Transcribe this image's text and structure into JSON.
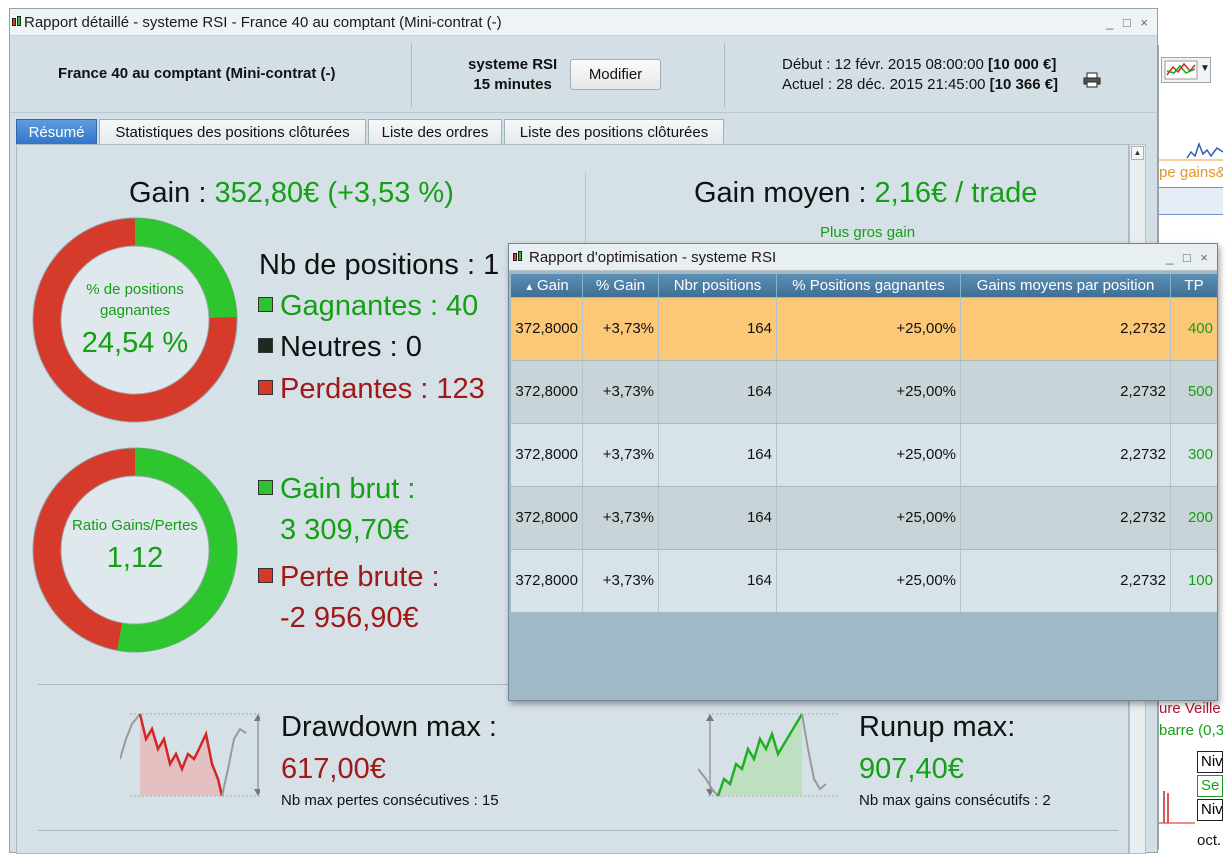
{
  "main_window": {
    "title": "Rapport détaillé - systeme RSI - France 40 au comptant (Mini-contrat  (-)",
    "controls": "_ □ ×"
  },
  "header": {
    "instrument": "France 40 au comptant (Mini-contrat  (-)",
    "system_name": "systeme RSI",
    "timeframe": "15 minutes",
    "modify_label": "Modifier",
    "start_label": "Début :",
    "start_date": "12 févr. 2015 08:00:00",
    "start_capital": "[10 000 €]",
    "current_label": "Actuel :",
    "current_date": "28 déc. 2015 21:45:00",
    "current_capital": "[10 366 €]"
  },
  "tabs": [
    {
      "label": "Résumé",
      "active": true
    },
    {
      "label": "Statistiques des positions clôturées",
      "active": false
    },
    {
      "label": "Liste des ordres",
      "active": false
    },
    {
      "label": "Liste des positions clôturées",
      "active": false
    }
  ],
  "summary": {
    "gain_label": "Gain :",
    "gain_value": "352,80€ (+3,53 %)",
    "avg_gain_label": "Gain moyen :",
    "avg_gain_value": "2,16€ / trade",
    "biggest_gain_label": "Plus gros gain",
    "win_donut": {
      "label": "% de positions gagnantes",
      "value": "24,54 %",
      "green_fraction": 0.2454
    },
    "ratio_donut": {
      "label": "Ratio Gains/Pertes",
      "value": "1,12",
      "green_fraction": 0.528
    },
    "nb_positions_label": "Nb de positions :",
    "nb_positions_partial": "1",
    "winners": "Gagnantes : 40",
    "neutral": "Neutres : 0",
    "losers": "Perdantes : 123",
    "gross_gain_label": "Gain brut :",
    "gross_gain_value": "3 309,70€",
    "gross_loss_label": "Perte brute :",
    "gross_loss_value": "-2 956,90€",
    "drawdown_label": "Drawdown max :",
    "drawdown_value": "617,00€",
    "max_losses_label": "Nb max pertes consécutives : 15",
    "runup_label": "Runup max:",
    "runup_value": "907,40€",
    "max_gains_label": "Nb max gains consécutifs : 2"
  },
  "optimisation_window": {
    "title": "Rapport d'optimisation - systeme RSI",
    "controls": "_ □ ×",
    "columns": [
      "Gain",
      "% Gain",
      "Nbr positions",
      "% Positions gagnantes",
      "Gains moyens par position",
      "TP"
    ],
    "sort_icon": "sort-up-arrow",
    "rows": [
      [
        "372,8000",
        "+3,73%",
        "164",
        "+25,00%",
        "2,2732",
        "400"
      ],
      [
        "372,8000",
        "+3,73%",
        "164",
        "+25,00%",
        "2,2732",
        "500"
      ],
      [
        "372,8000",
        "+3,73%",
        "164",
        "+25,00%",
        "2,2732",
        "300"
      ],
      [
        "372,8000",
        "+3,73%",
        "164",
        "+25,00%",
        "2,2732",
        "200"
      ],
      [
        "372,8000",
        "+3,73%",
        "164",
        "+25,00%",
        "2,2732",
        "100"
      ]
    ]
  },
  "background_window": {
    "fragment_1": "pe gains&",
    "fragment_2": "ure Veille",
    "fragment_3": "barre (0,3",
    "fragment_4": "Niv",
    "fragment_5": "Se",
    "fragment_6": "Niv",
    "fragment_7": "oct."
  },
  "colors": {
    "green": "#14a014",
    "red": "#a01818",
    "selected_row": "#fdc778",
    "tab_active": "#3a7fd0"
  }
}
